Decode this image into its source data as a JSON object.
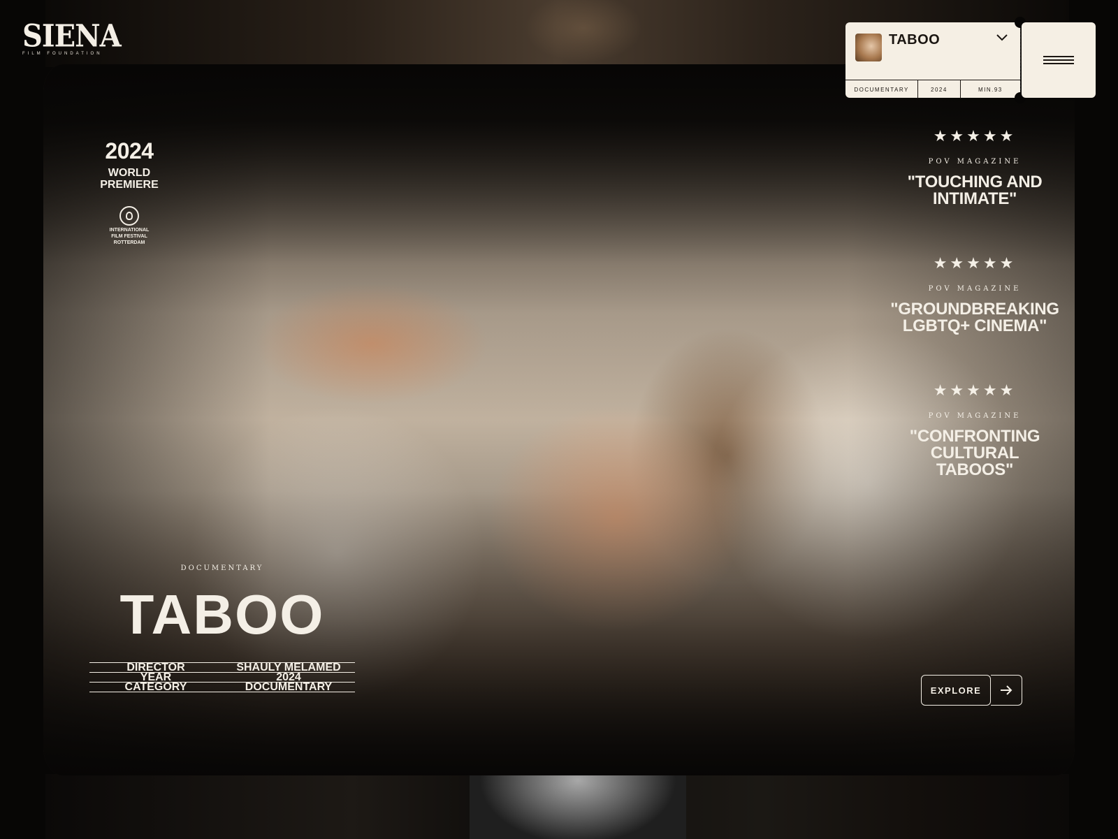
{
  "brand": {
    "name": "SIENA",
    "tagline": "FILM FOUNDATION"
  },
  "ticket": {
    "title": "TABOO",
    "meta": [
      "DOCUMENTARY",
      "2024",
      "MIN.93"
    ]
  },
  "premiere": {
    "year": "2024",
    "label": "WORLD\nPREMIERE",
    "festival": "INTERNATIONAL\nFILM FESTIVAL\nROTTERDAM"
  },
  "reviews": [
    {
      "stars": "★★★★★",
      "source": "POV MAGAZINE",
      "quote": "\"TOUCHING AND INTIMATE\""
    },
    {
      "stars": "★★★★★",
      "source": "POV MAGAZINE",
      "quote": "\"GROUNDBREAKING LGBTQ+ CINEMA\""
    },
    {
      "stars": "★★★★★",
      "source": "POV MAGAZINE",
      "quote": "\"CONFRONTING CULTURAL TABOOS\""
    }
  ],
  "film": {
    "genre_label": "DOCUMENTARY",
    "title": "TABOO",
    "credits": [
      {
        "label": "DIRECTOR",
        "value": "SHAULY MELAMED"
      },
      {
        "label": "YEAR",
        "value": "2024"
      },
      {
        "label": "CATEGORY",
        "value": "DOCUMENTARY"
      }
    ]
  },
  "cta": {
    "label": "EXPLORE",
    "arrow_icon": "arrow-right-icon"
  },
  "icons": {
    "chevron": "chevron-down-icon",
    "menu": "hamburger-icon",
    "festival": "lion-head-icon"
  }
}
